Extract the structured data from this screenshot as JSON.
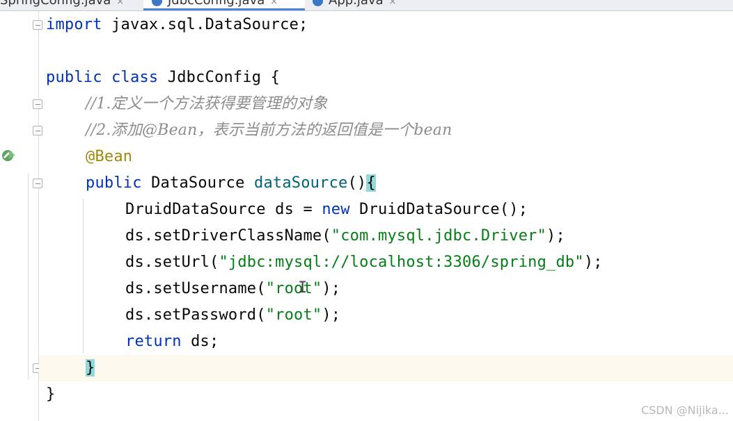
{
  "tabs": [
    {
      "label": "SpringConfig.java",
      "close": "×"
    },
    {
      "label": "JdbcConfig.java",
      "close": "×",
      "active": true
    },
    {
      "label": "App.java",
      "close": "×"
    }
  ],
  "code": {
    "import_kw": "import",
    "import_rest": " javax.sql.DataSource;",
    "class_kw": "public class",
    "class_rest": " JdbcConfig {",
    "comment1": "//1.定义一个方法获得要管理的对象",
    "comment2": "//2.添加@Bean，表示当前方法的返回值是一个bean",
    "annotation": "@Bean",
    "method_kw": "public",
    "method_type": " DataSource ",
    "method_name": "dataSource",
    "method_parens": "()",
    "method_brace": "{",
    "l7_type": "DruidDataSource ds = ",
    "l7_new": "new",
    "l7_rest": " DruidDataSource();",
    "l8_call": "ds.setDriverClassName(",
    "l8_str": "\"com.mysql.jdbc.Driver\"",
    "l8_end": ");",
    "l9_call": "ds.setUrl(",
    "l9_str": "\"jdbc:mysql://localhost:3306/spring_db\"",
    "l9_end": ");",
    "l10_call": "ds.setUsername(",
    "l10_str": "\"root\"",
    "l10_end": ");",
    "l11_call": "ds.setPassword(",
    "l11_str": "\"root\"",
    "l11_end": ");",
    "l12_kw": "return",
    "l12_rest": " ds;",
    "close_method": "}",
    "close_class": "}"
  },
  "cursor_glyph": "I",
  "watermark": "CSDN @Nijika..."
}
